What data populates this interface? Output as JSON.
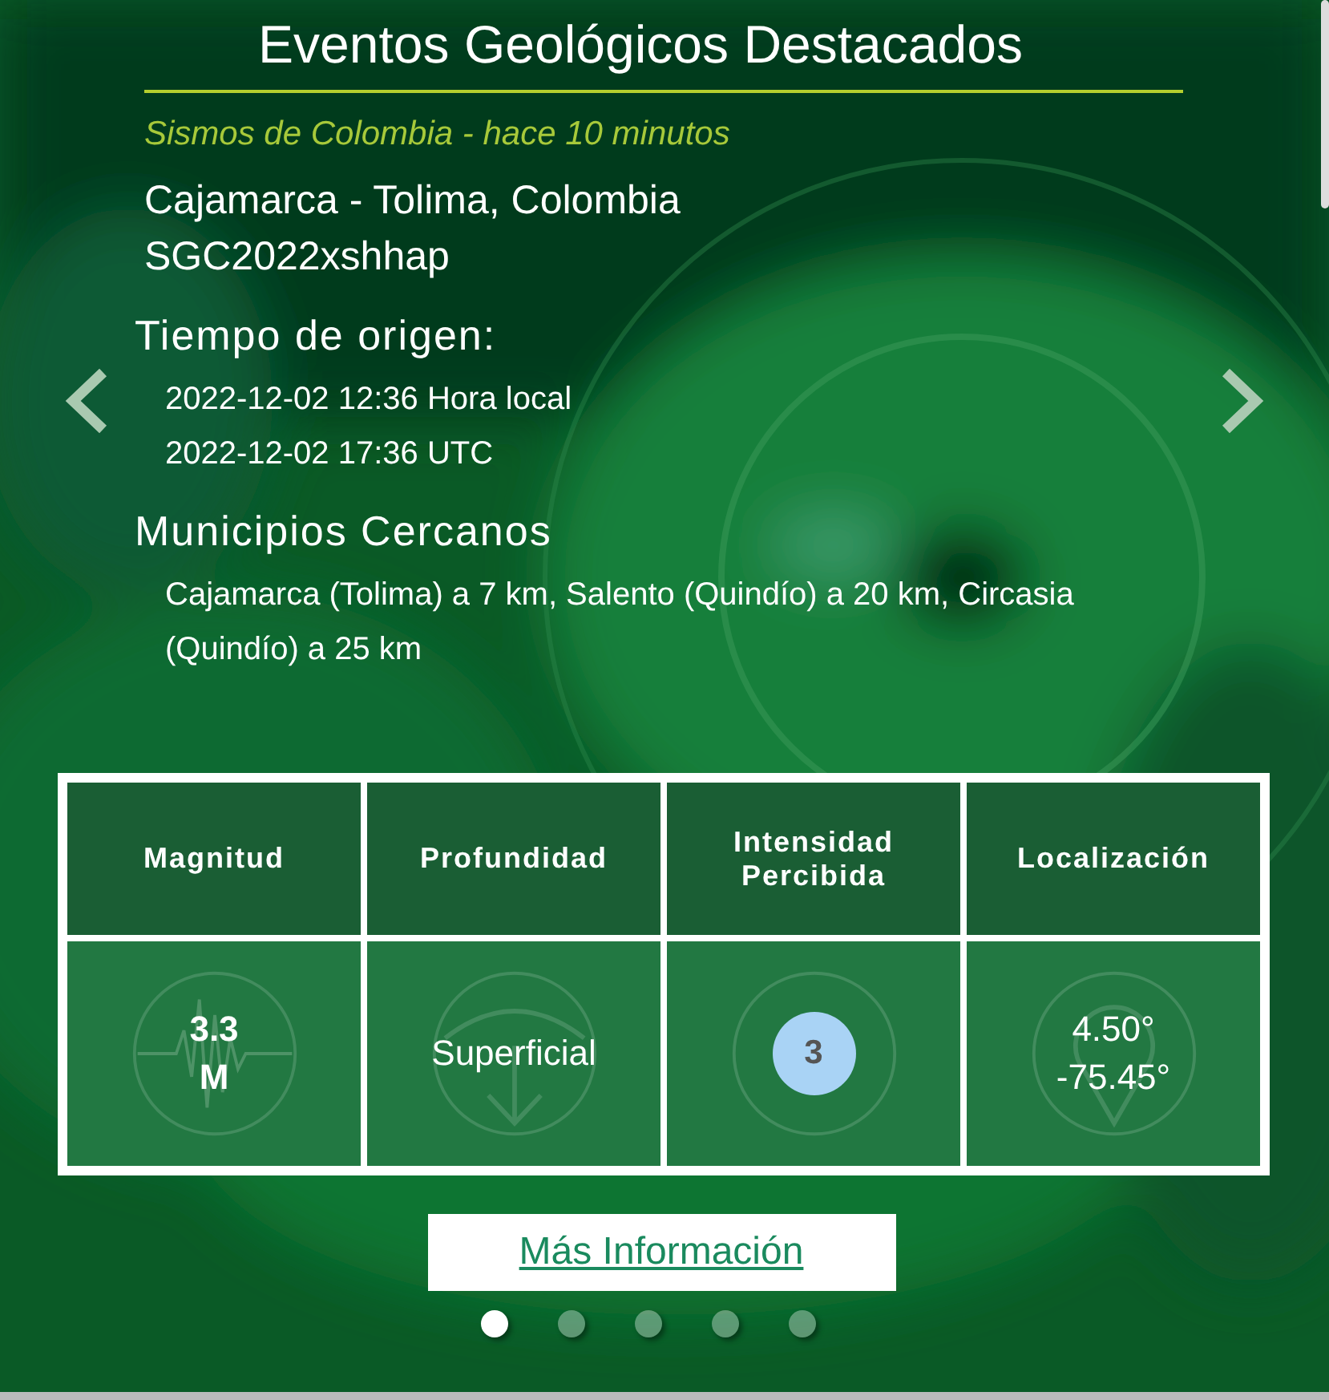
{
  "title": "Eventos Geológicos Destacados",
  "subtitle": "Sismos de Colombia - hace 10 minutos",
  "location_lines": [
    "Cajamarca - Tolima, Colombia",
    "SGC2022xshhap"
  ],
  "origin": {
    "heading": "Tiempo de origen:",
    "lines": [
      "2022-12-02 12:36 Hora local",
      "2022-12-02 17:36 UTC"
    ]
  },
  "nearby": {
    "heading": "Municipios Cercanos",
    "text": "Cajamarca (Tolima) a 7 km, Salento (Quindío) a 20 km, Circasia (Quindío) a 25 km"
  },
  "table": {
    "columns": [
      "Magnitud",
      "Profundidad",
      "Intensidad Percibida",
      "Localización"
    ],
    "cells": [
      {
        "kind": "magnitude",
        "lines": [
          "3.3",
          "M"
        ]
      },
      {
        "kind": "depth",
        "lines": [
          "Superficial"
        ]
      },
      {
        "kind": "intensity",
        "lines": [
          "3"
        ]
      },
      {
        "kind": "location",
        "lines": [
          "4.50°",
          "-75.45°"
        ]
      }
    ]
  },
  "link": "Más Información",
  "dots": [
    {
      "selected": true
    },
    {
      "selected": false
    },
    {
      "selected": false
    },
    {
      "selected": false
    },
    {
      "selected": false
    }
  ]
}
